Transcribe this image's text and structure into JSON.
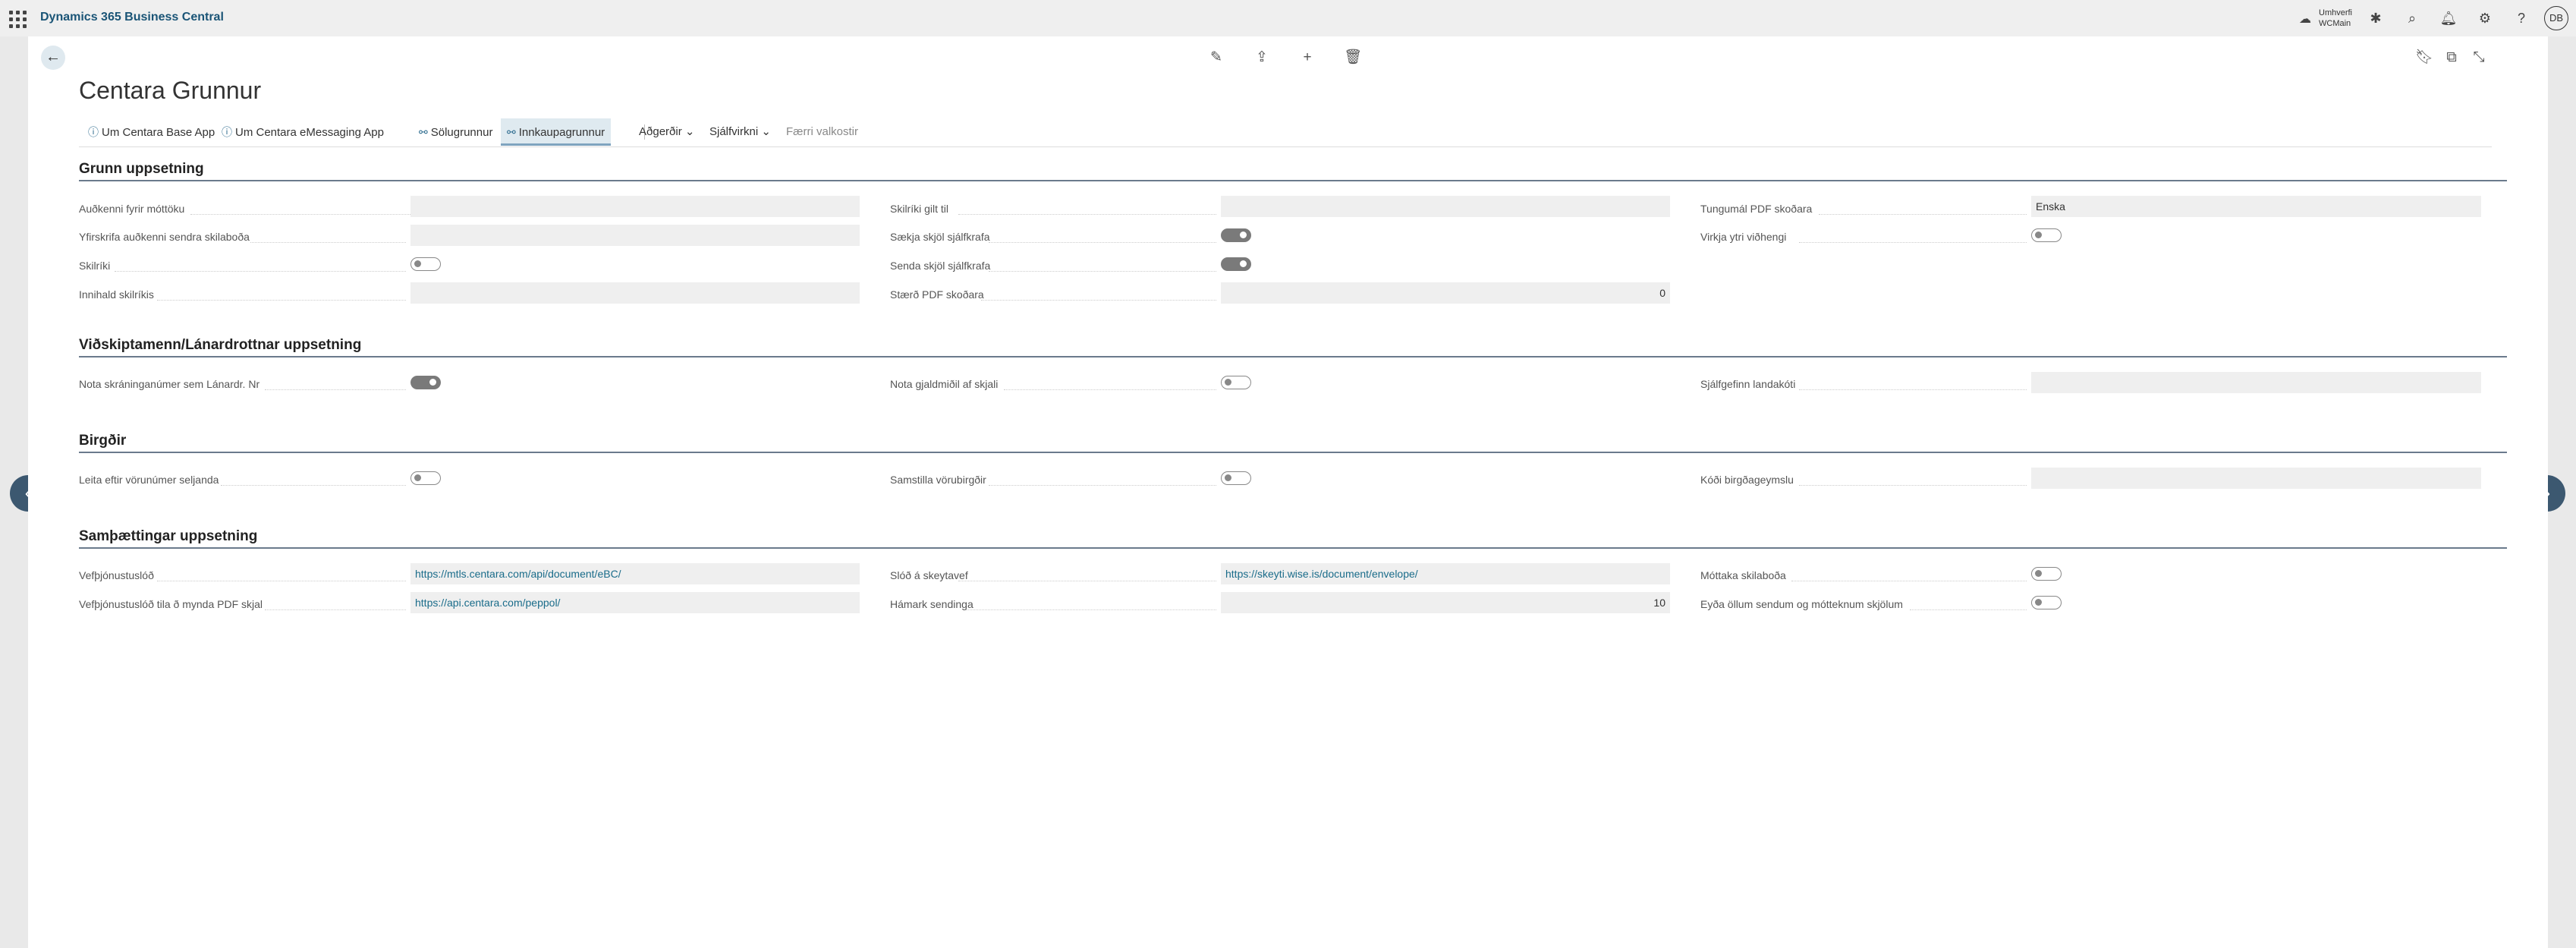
{
  "app": {
    "title": "Dynamics 365 Business Central"
  },
  "topbar": {
    "environment_line1": "Umhverfi",
    "environment_line2": "WCMain",
    "user_initials": "DB",
    "icons": [
      "waffle-icon",
      "environment-icon",
      "copilot-icon",
      "search-icon",
      "bell-icon",
      "gear-icon",
      "help-icon"
    ]
  },
  "page": {
    "title": "Centara Grunnur",
    "card_icons": [
      "edit-icon",
      "share-icon",
      "add-icon",
      "delete-icon",
      "bookmark-icon",
      "open-new-window-icon",
      "collapse-icon"
    ]
  },
  "actions": {
    "about_base": "Um Centara Base App",
    "about_emessaging": "Um Centara eMessaging App",
    "sales_base": "Sölugrunnur",
    "purchase_base": "Innkaupagrunnur",
    "actions_menu": "Aðgerðir",
    "automate_menu": "Sjálfvirkni",
    "fewer_options": "Færri valkostir"
  },
  "sections": {
    "grunn": {
      "title": "Grunn uppsetning",
      "recv_id_label": "Auðkenni fyrir móttöku",
      "override_sender_label": "Yfirskrifa auðkenni sendra skilaboða",
      "cert_label": "Skilríki",
      "cert_content_label": "Innihald skilríkis",
      "cert_valid_label": "Skilríki gilt til",
      "fetch_docs_label": "Sækja skjöl sjálfkrafa",
      "send_docs_label": "Senda skjöl sjálfkrafa",
      "pdf_size_label": "Stærð PDF skoðara",
      "pdf_size_value": "0",
      "pdf_lang_label": "Tungumál PDF skoðara",
      "pdf_lang_value": "Enska",
      "ext_attach_label": "Virkja ytri viðhengi",
      "toggles": {
        "cert": false,
        "fetch_docs": true,
        "send_docs": true,
        "ext_attach": false
      }
    },
    "vidskipta": {
      "title": "Viðskiptamenn/Lánardrottnar uppsetning",
      "use_reg_label": "Nota skráninganúmer sem Lánardr. Nr",
      "use_currency_label": "Nota gjaldmiðil af skjali",
      "default_country_label": "Sjálfgefinn landakóti",
      "toggles": {
        "use_reg": true,
        "use_currency": false
      }
    },
    "birgdir": {
      "title": "Birgðir",
      "search_vendor_label": "Leita eftir vörunúmer seljanda",
      "sync_inventory_label": "Samstilla vörubirgðir",
      "location_code_label": "Kóði birgðageymslu",
      "toggles": {
        "search_vendor": false,
        "sync_inventory": false
      }
    },
    "samth": {
      "title": "Samþættingar uppsetning",
      "ws_url_label": "Vefþjónustuslóð",
      "ws_url_value": "https://mtls.centara.com/api/document/eBC/",
      "ws_pdf_url_label": "Vefþjónustuslóð tila ð mynda PDF skjal",
      "ws_pdf_url_value": "https://api.centara.com/peppol/",
      "msg_url_label": "Slóð á skeytavef",
      "msg_url_value": "https://skeyti.wise.is/document/envelope/",
      "max_send_label": "Hámark sendinga",
      "max_send_value": "10",
      "receive_msgs_label": "Móttaka skilaboða",
      "delete_all_label": "Eyða öllum sendum og mótteknum skjölum",
      "toggles": {
        "receive_msgs": false,
        "delete_all": false
      }
    }
  },
  "colors": {
    "accent": "#1a5476",
    "nav_circle": "#3c5870",
    "section_line": "#6a7a8c"
  }
}
